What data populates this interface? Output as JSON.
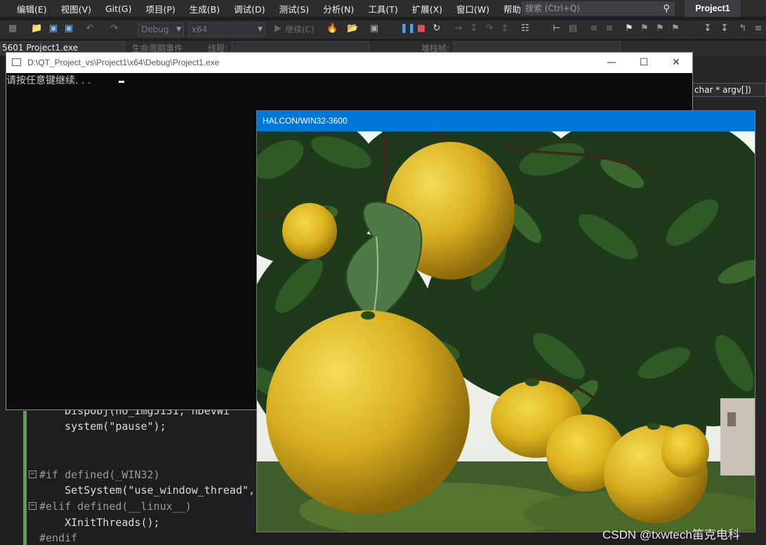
{
  "menu": {
    "items": [
      "编辑(E)",
      "视图(V)",
      "Git(G)",
      "项目(P)",
      "生成(B)",
      "调试(D)",
      "测试(S)",
      "分析(N)",
      "工具(T)",
      "扩展(X)",
      "窗口(W)",
      "帮助(H)"
    ],
    "search_placeholder": "搜索 (Ctrl+Q)",
    "project_title": "Project1"
  },
  "toolbar": {
    "config": "Debug",
    "platform": "x64",
    "continue_label": "继续(C)"
  },
  "debug_location": {
    "process": "5601 Project1.exe",
    "lifecycle_label": "生命周期事件",
    "thread_label": "线程:",
    "stack_label": "堆栈帧:"
  },
  "editor": {
    "signature_tip": "char * argv[])",
    "lines": {
      "l1": "    DispObj(ho_Img5131, hDevWi",
      "l2": "    system(\"pause\");",
      "l3": "#if defined(_WIN32)",
      "l4": "    SetSystem(\"use_window_thread\",",
      "l5": "#elif defined(__linux__)",
      "l6": "    XInitThreads();",
      "l7": "#endif"
    }
  },
  "console": {
    "title": "D:\\QT_Project_vs\\Project1\\x64\\Debug\\Project1.exe",
    "output": "请按任意键继续. . ."
  },
  "halcon": {
    "title": "HALCON/WIN32-3600"
  },
  "watermark": "CSDN @txwtech笛克电科",
  "colors": {
    "vs_chrome": "#2d2d30",
    "editor_bg": "#1e1e1e",
    "halcon_title": "#0078d7",
    "console_bg": "#0c0c0c"
  }
}
